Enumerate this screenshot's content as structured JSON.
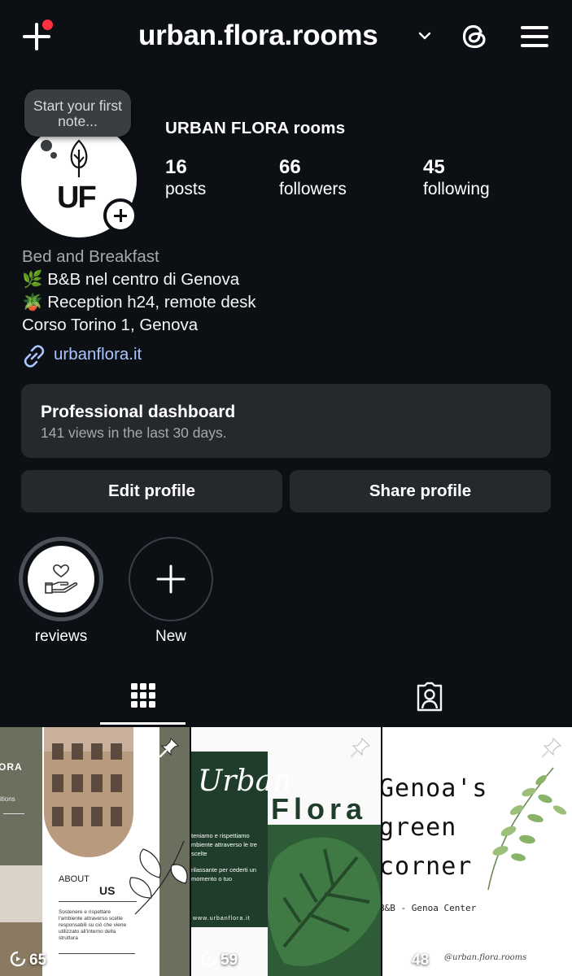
{
  "header": {
    "username": "urban.flora.rooms",
    "icons": [
      "create-icon",
      "chevron-down-icon",
      "threads-icon",
      "menu-icon"
    ]
  },
  "note": {
    "placeholder": "Start your first note..."
  },
  "profile": {
    "avatar_text": "UF",
    "display_name": "URBAN FLORA rooms",
    "stats": [
      {
        "value": "16",
        "label": "posts"
      },
      {
        "value": "66",
        "label": "followers"
      },
      {
        "value": "45",
        "label": "following"
      }
    ],
    "category": "Bed and Breakfast",
    "bio_lines": [
      "🌿 B&B nel centro di Genova",
      "🪴 Reception h24, remote desk",
      "Corso Torino 1, Genova"
    ],
    "link": "urbanflora.it"
  },
  "dashboard": {
    "title": "Professional dashboard",
    "subtitle": "141 views in the last 30 days."
  },
  "buttons": {
    "edit": "Edit profile",
    "share": "Share profile"
  },
  "highlights": [
    {
      "label": "reviews"
    },
    {
      "label": "New"
    }
  ],
  "tabs": [
    {
      "name": "posts-grid",
      "active": true
    },
    {
      "name": "tagged",
      "active": false
    }
  ],
  "posts": [
    {
      "views": "65",
      "pinned": true,
      "text": {
        "brand": "ORA",
        "sub": "itions",
        "about": "ABOUT",
        "us": "US",
        "body": "Sostenere e rispettare l'ambiente attraverso scelte responsabili su ciò che viene utilizzato all'interno della struttura"
      }
    },
    {
      "views": "59",
      "pinned": true,
      "text": {
        "script": "Urban",
        "title": "Flora",
        "body1": "teniamo e rispettiamo mbiente attraverso le tre scelte",
        "body2": "rilassante per cederti un momento o tuo",
        "url": "www.urbanflora.it"
      }
    },
    {
      "views": "48",
      "pinned": true,
      "text": {
        "line1": "Genoa's",
        "line2": "green",
        "line3": "corner",
        "sub": "B&B - Genoa Center",
        "handle": "@urban.flora.rooms"
      }
    }
  ],
  "colors": {
    "background": "#0c1014",
    "surface": "#25292e",
    "link": "#a9c6ff",
    "notification": "#ff3040"
  }
}
